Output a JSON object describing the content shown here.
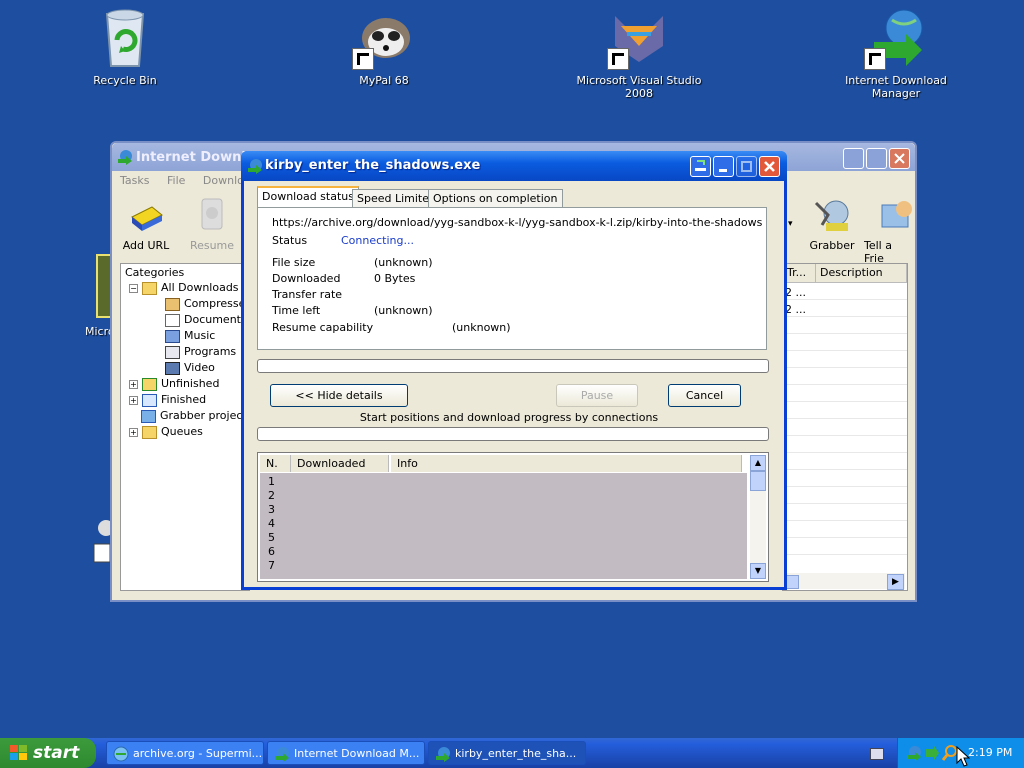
{
  "desktop": {
    "icons": [
      {
        "label": "Recycle Bin"
      },
      {
        "label": "MyPal 68"
      },
      {
        "label": "Microsoft Visual Studio 2008"
      },
      {
        "label": "Internet Download Manager"
      }
    ],
    "partial_label": "Micro"
  },
  "idm_window": {
    "title": "Internet Download",
    "menu": [
      "Tasks",
      "File",
      "Downloads"
    ],
    "toolbar": {
      "add_url": "Add URL",
      "resume": "Resume",
      "grabber": "Grabber",
      "tell_friend": "Tell a Frie"
    },
    "categories": {
      "header": "Categories",
      "items": [
        "All Downloads",
        "Compressed",
        "Documents",
        "Music",
        "Programs",
        "Video",
        "Unfinished",
        "Finished",
        "Grabber project",
        "Queues"
      ]
    },
    "list": {
      "col_tr": "Tr...",
      "col_description": "Description",
      "rows": [
        "2 ...",
        "2 ..."
      ]
    }
  },
  "dialog": {
    "title": "kirby_enter_the_shadows.exe",
    "tabs": [
      "Download status",
      "Speed Limiter",
      "Options on completion"
    ],
    "url": "https://archive.org/download/yyg-sandbox-k-l/yyg-sandbox-k-l.zip/kirby-into-the-shadows/kirby_en",
    "status_label": "Status",
    "status_value": "Connecting...",
    "fields": [
      {
        "label": "File size",
        "value": "(unknown)"
      },
      {
        "label": "Downloaded",
        "value": "0 Bytes"
      },
      {
        "label": "Transfer rate",
        "value": ""
      },
      {
        "label": "Time left",
        "value": "(unknown)"
      }
    ],
    "resume_label": "Resume capability",
    "resume_value": "(unknown)",
    "buttons": {
      "hide_details": "<< Hide details",
      "pause": "Pause",
      "cancel": "Cancel"
    },
    "connections_caption": "Start positions and download progress by connections",
    "table": {
      "headers": [
        "N.",
        "Downloaded",
        "Info"
      ],
      "rows": [
        "1",
        "2",
        "3",
        "4",
        "5",
        "6",
        "7"
      ]
    }
  },
  "taskbar": {
    "start": "start",
    "tasks": [
      "archive.org - Supermi...",
      "Internet Download M...",
      "kirby_enter_the_sha..."
    ],
    "clock": "2:19 PM"
  },
  "colors": {
    "desktop": "#1d4ea0",
    "xp_title": "#0b5ce0",
    "status_text": "#1a3cc8"
  }
}
